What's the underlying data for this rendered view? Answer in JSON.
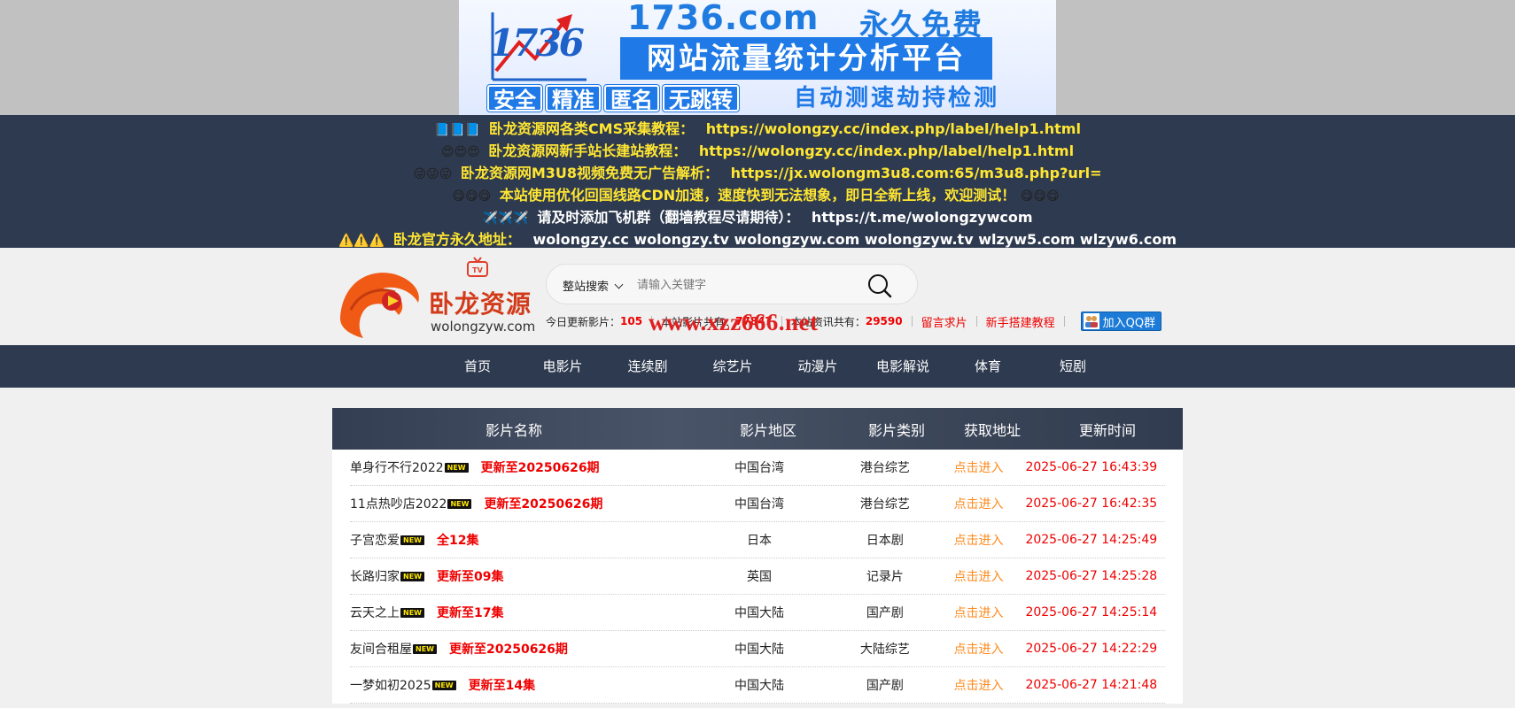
{
  "ad": {
    "logo_text": "1736",
    "domain": "1736.com",
    "free": "永久免费",
    "platform": "网站流量统计分析平台",
    "tags": [
      "安全",
      "精准",
      "匿名",
      "无跳转"
    ],
    "slogan": "自动测速劫持检测"
  },
  "notices": [
    {
      "emoji": "📘📘📘",
      "label": "卧龙资源网各类CMS采集教程：",
      "value": "https://wolongzy.cc/index.php/label/help1.html",
      "style": "yellow"
    },
    {
      "emoji": "😍😍😍",
      "label": "卧龙资源网新手站长建站教程：",
      "value": "https://wolongzy.cc/index.php/label/help1.html",
      "style": "yellow"
    },
    {
      "emoji": "😜😜😜",
      "label": "卧龙资源网M3U8视频免费无广告解析：",
      "value": "https://jx.wolongm3u8.com:65/m3u8.php?url=",
      "style": "yellow"
    },
    {
      "emoji": "😋😋😋",
      "label": "本站使用优化回国线路CDN加速，速度快到无法想象，即日全新上线，欢迎测试！",
      "value": "😋😋😋",
      "style": "yellow"
    },
    {
      "emoji": "✈️✈️✈️",
      "label": "请及时添加飞机群（翻墙教程尽请期待）：",
      "value": "https://t.me/wolongzywcom",
      "style": "white"
    },
    {
      "emoji": "⚠️⚠️⚠️",
      "label": "卧龙官方永久地址：",
      "value": "wolongzy.cc wolongzy.tv wolongzyw.com wolongzyw.tv wlzyw5.com wlzyw6.com",
      "style": "addr"
    }
  ],
  "header": {
    "logo_brand": "卧龙资源",
    "logo_domain": "wolongzyw.com",
    "search_scope": "整站搜索",
    "search_placeholder": "请输入关键字",
    "stats": {
      "today_label": "今日更新影片：",
      "today_value": "105",
      "total_label": "本站影片共有：",
      "total_value": "77847",
      "news_label": "本站资讯共有：",
      "news_value": "29590"
    },
    "links": [
      "留言求片",
      "新手搭建教程"
    ],
    "qq_label": "加入QQ群",
    "watermark": "www.xzz666.net"
  },
  "nav": [
    "首页",
    "电影片",
    "连续剧",
    "综艺片",
    "动漫片",
    "电影解说",
    "体育",
    "短剧"
  ],
  "table": {
    "headers": [
      "影片名称",
      "影片地区",
      "影片类别",
      "获取地址",
      "更新时间"
    ],
    "new_badge": "NEW",
    "rows": [
      {
        "title": "单身行不行2022",
        "status": "更新至20250626期",
        "area": "中国台湾",
        "type": "港台综艺",
        "link": "点击进入",
        "time": "2025-06-27 16:43:39"
      },
      {
        "title": "11点热吵店2022",
        "status": "更新至20250626期",
        "area": "中国台湾",
        "type": "港台综艺",
        "link": "点击进入",
        "time": "2025-06-27 16:42:35"
      },
      {
        "title": "子宫恋爱",
        "status": "全12集",
        "area": "日本",
        "type": "日本剧",
        "link": "点击进入",
        "time": "2025-06-27 14:25:49"
      },
      {
        "title": "长路归家",
        "status": "更新至09集",
        "area": "英国",
        "type": "记录片",
        "link": "点击进入",
        "time": "2025-06-27 14:25:28"
      },
      {
        "title": "云天之上",
        "status": "更新至17集",
        "area": "中国大陆",
        "type": "国产剧",
        "link": "点击进入",
        "time": "2025-06-27 14:25:14"
      },
      {
        "title": "友间合租屋",
        "status": "更新至20250626期",
        "area": "中国大陆",
        "type": "大陆综艺",
        "link": "点击进入",
        "time": "2025-06-27 14:22:29"
      },
      {
        "title": "一梦如初2025",
        "status": "更新至14集",
        "area": "中国大陆",
        "type": "国产剧",
        "link": "点击进入",
        "time": "2025-06-27 14:21:48"
      }
    ]
  },
  "colors": {
    "notice_bg": "#2e3a4f",
    "accent_red": "#e00000",
    "link_orange": "#ff8a1d",
    "notice_yellow": "#ffe633"
  }
}
